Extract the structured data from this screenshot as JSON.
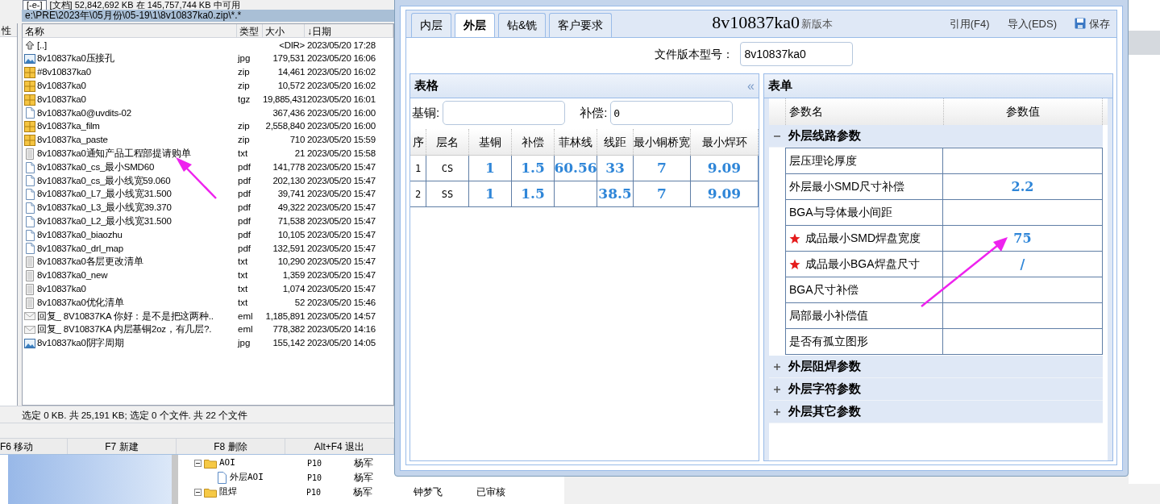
{
  "file_manager": {
    "drive": "[-e-]",
    "free_space": "[文档] 52,842,692 KB 在 145,757,744 KB 中可用",
    "path": "e:\\PRE\\2023年\\05月份\\05-19\\1\\8v10837ka0.zip\\*.*",
    "side_header": "性",
    "columns": [
      "名称",
      "类型",
      "大小",
      "↓日期"
    ],
    "files": [
      {
        "kind": "up",
        "name": "[..]",
        "size": "<DIR>",
        "date": "2023/05/20 17:28"
      },
      {
        "kind": "image",
        "name": "8v10837ka0压接孔",
        "type": "jpg",
        "size": "179,531",
        "date": "2023/05/20 16:06"
      },
      {
        "kind": "archive",
        "name": "#8v10837ka0",
        "type": "zip",
        "size": "14,461",
        "date": "2023/05/20 16:02"
      },
      {
        "kind": "archive",
        "name": "8v10837ka0",
        "type": "zip",
        "size": "10,572",
        "date": "2023/05/20 16:02"
      },
      {
        "kind": "archive",
        "name": "8v10837ka0",
        "type": "tgz",
        "size": "19,885,431",
        "date": "2023/05/20 16:01"
      },
      {
        "kind": "page",
        "name": "8v10837ka0@uvdits-02",
        "size": "367,436",
        "date": "2023/05/20 16:00"
      },
      {
        "kind": "archive",
        "name": "8v10837ka_film",
        "type": "zip",
        "size": "2,558,840",
        "date": "2023/05/20 16:00"
      },
      {
        "kind": "archive",
        "name": "8v10837ka_paste",
        "type": "zip",
        "size": "710",
        "date": "2023/05/20 15:59"
      },
      {
        "kind": "text",
        "name": "8v10837ka0通知产品工程部提请购单",
        "type": "txt",
        "size": "21",
        "date": "2023/05/20 15:58"
      },
      {
        "kind": "page",
        "name": "8v10837ka0_cs_最小SMD60",
        "type": "pdf",
        "size": "141,778",
        "date": "2023/05/20 15:47"
      },
      {
        "kind": "page",
        "name": "8v10837ka0_cs_最小线宽59.060",
        "type": "pdf",
        "size": "202,130",
        "date": "2023/05/20 15:47"
      },
      {
        "kind": "page",
        "name": "8v10837ka0_L7_最小线宽31.500",
        "type": "pdf",
        "size": "39,741",
        "date": "2023/05/20 15:47"
      },
      {
        "kind": "page",
        "name": "8v10837ka0_L3_最小线宽39.370",
        "type": "pdf",
        "size": "49,322",
        "date": "2023/05/20 15:47"
      },
      {
        "kind": "page",
        "name": "8v10837ka0_L2_最小线宽31.500",
        "type": "pdf",
        "size": "71,538",
        "date": "2023/05/20 15:47"
      },
      {
        "kind": "page",
        "name": "8v10837ka0_biaozhu",
        "type": "pdf",
        "size": "10,105",
        "date": "2023/05/20 15:47"
      },
      {
        "kind": "page",
        "name": "8v10837ka0_drl_map",
        "type": "pdf",
        "size": "132,591",
        "date": "2023/05/20 15:47"
      },
      {
        "kind": "text",
        "name": "8v10837ka0各层更改清单",
        "type": "txt",
        "size": "10,290",
        "date": "2023/05/20 15:47"
      },
      {
        "kind": "text",
        "name": "8v10837ka0_new",
        "type": "txt",
        "size": "1,359",
        "date": "2023/05/20 15:47"
      },
      {
        "kind": "text",
        "name": "8v10837ka0",
        "type": "txt",
        "size": "1,074",
        "date": "2023/05/20 15:47"
      },
      {
        "kind": "text",
        "name": "8v10837ka0优化清单",
        "type": "txt",
        "size": "52",
        "date": "2023/05/20 15:46"
      },
      {
        "kind": "mail",
        "name": "回复_ 8V10837KA 你好：是不是把这两种..",
        "type": "eml",
        "size": "1,185,891",
        "date": "2023/05/20 14:57"
      },
      {
        "kind": "mail",
        "name": "回复_ 8V10837KA 内层基铜2oz，有几层?.",
        "type": "eml",
        "size": "778,382",
        "date": "2023/05/20 14:16"
      },
      {
        "kind": "image",
        "name": "8v10837ka0阴字周期",
        "type": "jpg",
        "size": "155,142",
        "date": "2023/05/20 14:05"
      }
    ],
    "status": "选定 0 KB. 共 25,191 KB; 选定 0 个文件. 共 22 个文件",
    "function_keys": [
      "F6 移动",
      "F7 新建",
      "F8 删除",
      "Alt+F4 退出"
    ]
  },
  "review_window": {
    "rows": [
      {
        "kind": "folder",
        "label": "AOI",
        "expanded": true,
        "cells": [
          "P10",
          "杨军"
        ],
        "children": [
          {
            "kind": "file",
            "label": "外层AOI",
            "cells": [
              "P10",
              "杨军"
            ]
          }
        ]
      },
      {
        "kind": "folder",
        "label": "阻焊",
        "expanded": true,
        "cells": [
          "P10",
          "杨军",
          "钟梦飞",
          "已审核"
        ]
      }
    ]
  },
  "dialog": {
    "tabs": [
      {
        "label": "内层",
        "selected": false
      },
      {
        "label": "外层",
        "selected": true
      },
      {
        "label": "钻&铣",
        "selected": false
      },
      {
        "label": "客户要求",
        "selected": false
      }
    ],
    "title": "8v10837ka0",
    "title_suffix": "新版本",
    "actions": [
      {
        "kind": "text",
        "label": "引用(F4)"
      },
      {
        "kind": "text",
        "label": "导入(EDS)"
      },
      {
        "kind": "save",
        "label": "保存"
      }
    ],
    "version_label": "文件版本型号：",
    "version_value": "8v10837ka0",
    "grid_panel": {
      "title": "表格",
      "collapse_glyph": "«",
      "filters": [
        {
          "label": "基铜:"
        },
        {
          "label": "补偿:",
          "value": "0"
        }
      ],
      "columns": [
        "序",
        "层名",
        "基铜",
        "补偿",
        "菲林线",
        "线距",
        "最小铜桥宽",
        "最小焊环"
      ],
      "rows": [
        [
          "1",
          "CS",
          "1",
          "1.5",
          "60.56",
          "33",
          "7",
          "9.09"
        ],
        [
          "2",
          "SS",
          "1",
          "1.5",
          null,
          "38.5",
          "7",
          "9.09"
        ]
      ]
    },
    "form_panel": {
      "title": "表单",
      "columns": [
        "参数名",
        "参数值"
      ],
      "groups": [
        {
          "label": "外层线路参数",
          "expanded": true,
          "params": [
            {
              "name": "层压理论厚度",
              "required": false
            },
            {
              "name": "外层最小SMD尺寸补偿",
              "value": "2.2",
              "required": false
            },
            {
              "name": "BGA与导体最小间距",
              "required": false
            },
            {
              "name": "成品最小SMD焊盘宽度",
              "value": "75",
              "required": true
            },
            {
              "name": "成品最小BGA焊盘尺寸",
              "value": "/",
              "required": true
            },
            {
              "name": "BGA尺寸补偿",
              "required": false
            },
            {
              "name": "局部最小补偿值",
              "required": false
            },
            {
              "name": "是否有孤立图形",
              "required": false
            }
          ]
        },
        {
          "label": "外层阻焊参数",
          "expanded": false
        },
        {
          "label": "外层字符参数",
          "expanded": false
        },
        {
          "label": "外层其它参数",
          "expanded": false
        }
      ]
    }
  }
}
